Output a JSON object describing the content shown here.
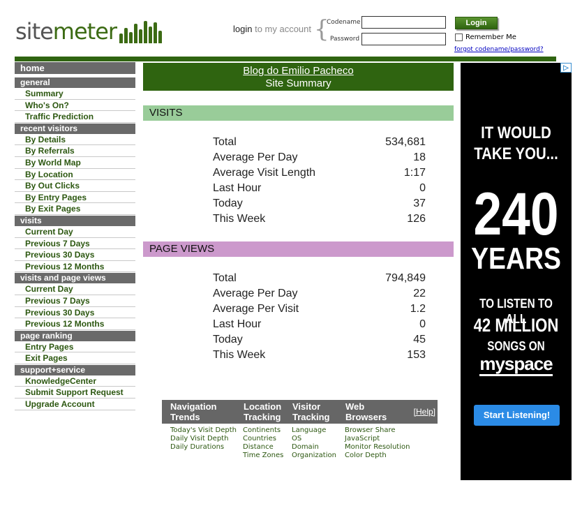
{
  "header": {
    "logo_site": "site",
    "logo_meter": "meter",
    "login_strong": "login",
    "login_rest": " to my account",
    "codename_label": "Codename",
    "password_label": "Password",
    "login_button": "Login",
    "remember_label": "Remember Me",
    "forgot_link": "forgot codename/password?"
  },
  "sidebar": {
    "home": "home",
    "sections": [
      {
        "title": "general",
        "items": [
          "Summary",
          "Who's On?",
          "Traffic Prediction"
        ]
      },
      {
        "title": "recent visitors",
        "items": [
          "By Details",
          "By Referrals",
          "By World Map",
          "By Location",
          "By Out Clicks",
          "By Entry Pages",
          "By Exit Pages"
        ]
      },
      {
        "title": "visits",
        "items": [
          "Current Day",
          "Previous 7 Days",
          "Previous 30 Days",
          "Previous 12 Months"
        ]
      },
      {
        "title": "visits and page views",
        "items": [
          "Current Day",
          "Previous 7 Days",
          "Previous 30 Days",
          "Previous 12 Months"
        ]
      },
      {
        "title": "page ranking",
        "items": [
          "Entry Pages",
          "Exit Pages"
        ]
      },
      {
        "title": "support+service",
        "items": [
          "KnowledgeCenter",
          "Submit Support Request",
          "Upgrade Account"
        ]
      }
    ]
  },
  "main": {
    "blog_title": "Blog do Emilio Pacheco",
    "summary_title": "Site Summary",
    "visits_heading": "VISITS",
    "visits": [
      {
        "label": "Total",
        "value": "534,681"
      },
      {
        "label": "Average Per Day",
        "value": "18"
      },
      {
        "label": "Average Visit Length",
        "value": "1:17"
      },
      {
        "label": "Last Hour",
        "value": "0"
      },
      {
        "label": "Today",
        "value": "37"
      },
      {
        "label": "This Week",
        "value": "126"
      }
    ],
    "pageviews_heading": "PAGE VIEWS",
    "pageviews": [
      {
        "label": "Total",
        "value": "794,849"
      },
      {
        "label": "Average Per Day",
        "value": "22"
      },
      {
        "label": "Average Per Visit",
        "value": "1.2"
      },
      {
        "label": "Last Hour",
        "value": "0"
      },
      {
        "label": "Today",
        "value": "45"
      },
      {
        "label": "This Week",
        "value": "153"
      }
    ]
  },
  "nav_table": {
    "headers": [
      {
        "line1": "Navigation",
        "line2": "Trends"
      },
      {
        "line1": "Location",
        "line2": "Tracking"
      },
      {
        "line1": "Visitor",
        "line2": "Tracking"
      },
      {
        "line1": "Web",
        "line2": "Browsers"
      }
    ],
    "help": "[Help]",
    "columns": [
      [
        "Today's Visit Depth",
        "Daily Visit Depth",
        "Daily Durations"
      ],
      [
        "Continents",
        "Countries",
        "Distance",
        "Time Zones"
      ],
      [
        "Language",
        "OS",
        "Domain",
        "Organization"
      ],
      [
        "Browser Share",
        "JavaScript",
        "Monitor Resolution",
        "Color Depth"
      ]
    ]
  },
  "ad": {
    "close": "▷",
    "line1a": "IT WOULD",
    "line1b": "TAKE YOU...",
    "number": "240",
    "years": "YEARS",
    "listen": "TO LISTEN TO ALL",
    "millions": "42 MILLION",
    "songs": "SONGS ON",
    "brand": "myspace",
    "button": "Start Listening!"
  },
  "colors": {
    "brand_green": "#2f6410",
    "visits_band": "#99cc99",
    "pageviews_band": "#cc99cc",
    "sidebar_header": "#6a6a6a"
  }
}
